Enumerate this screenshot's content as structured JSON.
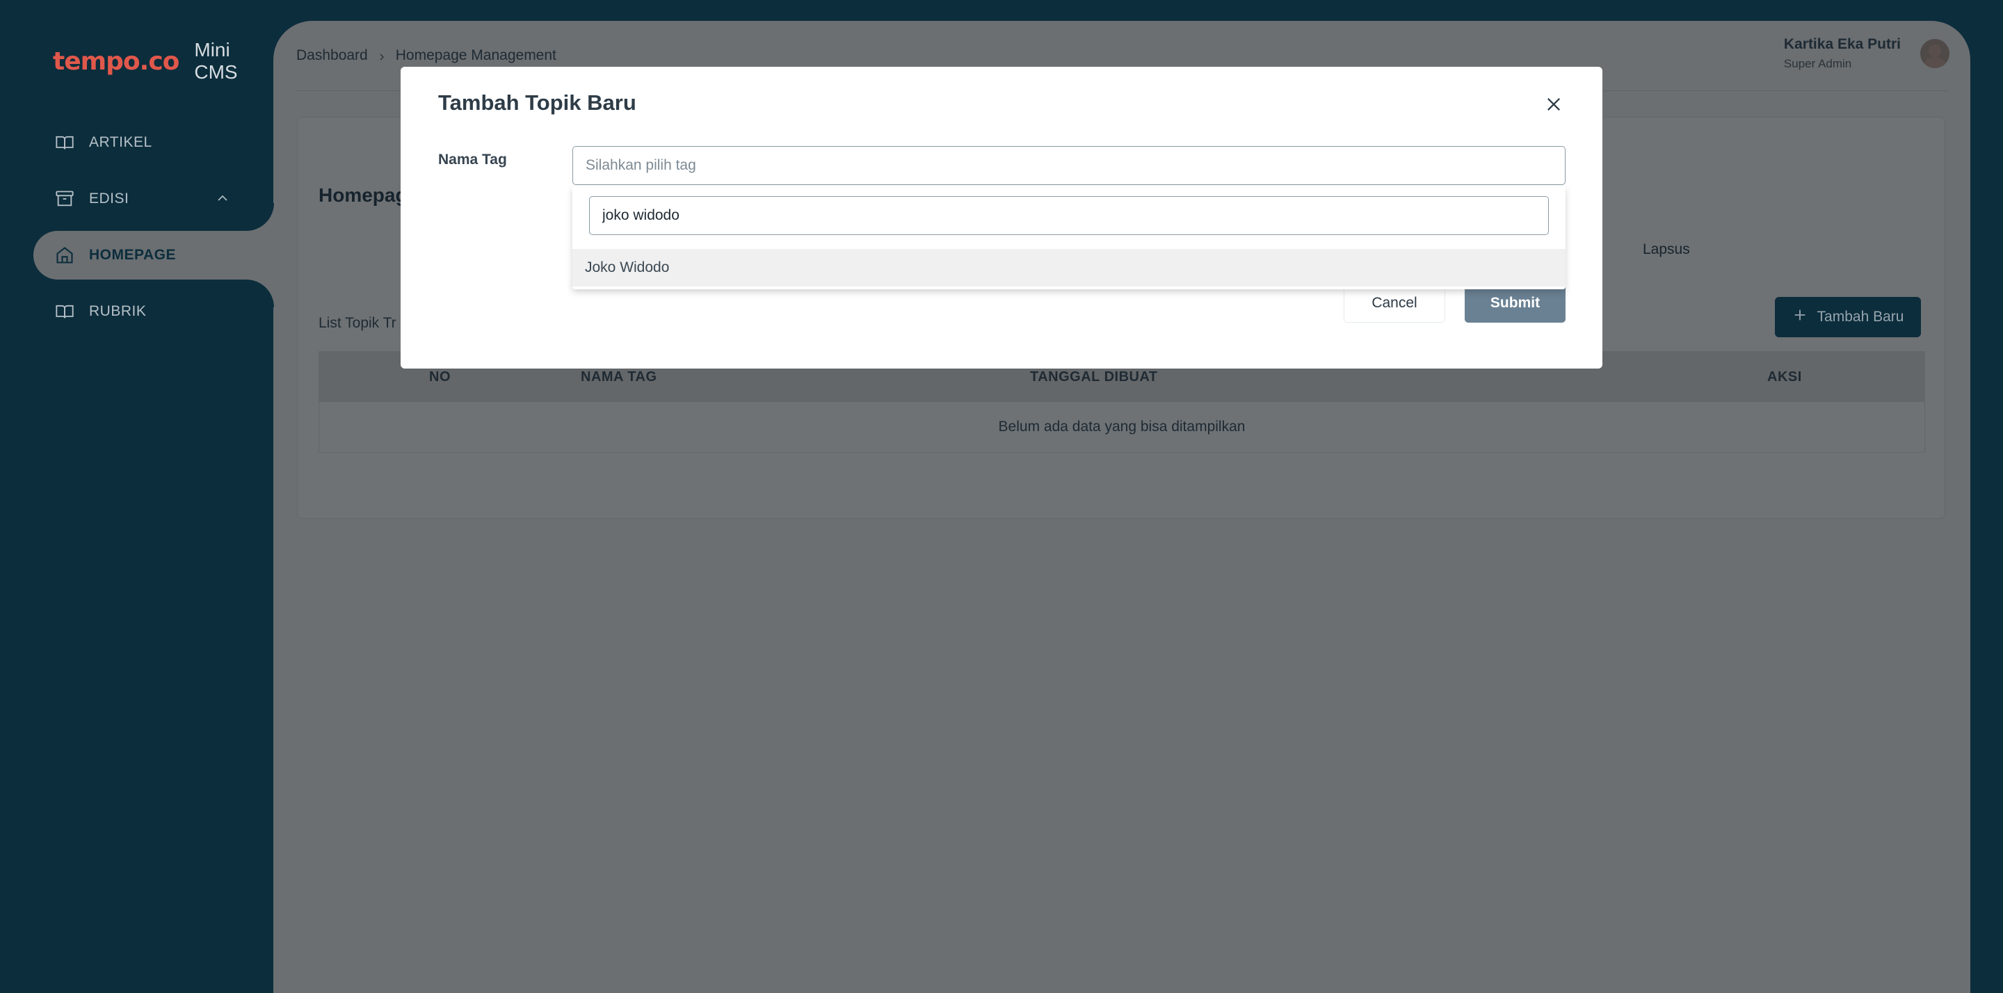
{
  "app": {
    "brand": "tempo.co",
    "name": "Mini CMS"
  },
  "sidebar": {
    "items": [
      {
        "label": "ARTIKEL",
        "icon": "book-icon"
      },
      {
        "label": "EDISI",
        "icon": "archive-icon",
        "expanded": true
      },
      {
        "label": "HOMEPAGE",
        "icon": "home-icon",
        "active": true
      },
      {
        "label": "RUBRIK",
        "icon": "book-icon"
      }
    ]
  },
  "breadcrumb": {
    "root": "Dashboard",
    "current": "Homepage Management"
  },
  "user": {
    "name": "Kartika Eka Putri",
    "role": "Super Admin"
  },
  "page": {
    "title": "Homepag",
    "tab_lapsus": "Lapsus",
    "list_title": "List Topik Tr",
    "add_button": "Tambah Baru"
  },
  "table": {
    "headers": [
      "NO",
      "NAMA TAG",
      "TANGGAL DIBUAT",
      "AKSI"
    ],
    "empty_text": "Belum ada data yang bisa ditampilkan"
  },
  "modal": {
    "title": "Tambah Topik Baru",
    "field_label": "Nama Tag",
    "select_placeholder": "Silahkan pilih tag",
    "search_value": "joko widodo",
    "options": [
      "Joko Widodo"
    ],
    "cancel_label": "Cancel",
    "submit_label": "Submit"
  },
  "colors": {
    "sidebar_bg": "#0c2d3c",
    "brand_red": "#e0584b",
    "submit_bg": "#6a8193",
    "overlay_panel": "#6b6f72"
  }
}
